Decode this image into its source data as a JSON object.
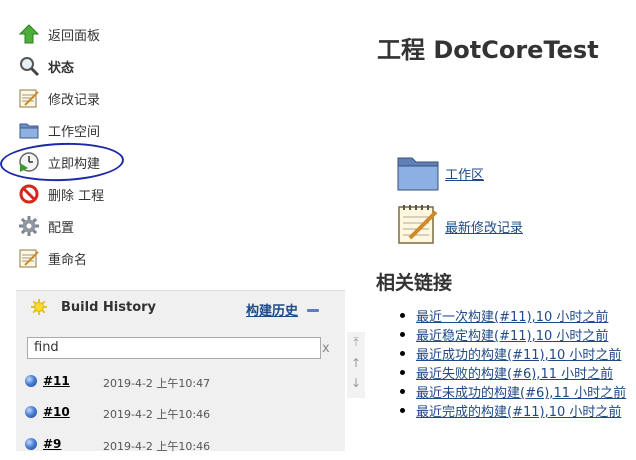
{
  "tasks": [
    {
      "label": "返回面板",
      "icon": "up-arrow-icon"
    },
    {
      "label": "状态",
      "icon": "search-icon"
    },
    {
      "label": "修改记录",
      "icon": "notepad-icon"
    },
    {
      "label": "工作空间",
      "icon": "folder-icon"
    },
    {
      "label": "立即构建",
      "icon": "clock-play-icon"
    },
    {
      "label": "删除 工程",
      "icon": "no-entry-icon"
    },
    {
      "label": "配置",
      "icon": "gear-icon"
    },
    {
      "label": "重命名",
      "icon": "notepad-icon"
    }
  ],
  "build_history": {
    "title": "Build History",
    "link_label": "构建历史",
    "search_placeholder": "find",
    "clear_label": "x",
    "rows": [
      {
        "number": "#11",
        "date": "2019-4-2 上午10:47"
      },
      {
        "number": "#10",
        "date": "2019-4-2 上午10:46"
      },
      {
        "number": "#9",
        "date": "2019-4-2 上午10:46"
      }
    ]
  },
  "main": {
    "title": "工程 DotCoreTest",
    "workspace_label": "工作区",
    "changes_label": "最新修改记录",
    "related_title": "相关链接",
    "links": [
      "最近一次构建(#11),10 小时之前",
      "最近稳定构建(#11),10 小时之前",
      "最近成功的构建(#11),10 小时之前",
      "最近失败的构建(#6),11 小时之前",
      "最近未成功的构建(#6),11 小时之前",
      "最近完成的构建(#11),10 小时之前"
    ]
  },
  "colors": {
    "link": "#204a87",
    "annotation_ring": "#1f2aa8",
    "widget_bg": "#f0f0f0"
  }
}
